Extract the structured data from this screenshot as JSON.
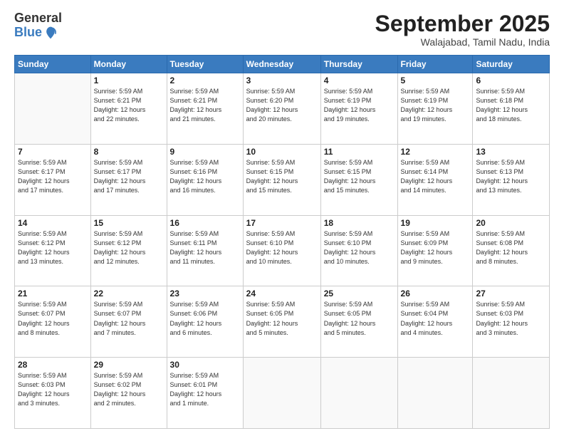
{
  "logo": {
    "general": "General",
    "blue": "Blue"
  },
  "title": "September 2025",
  "location": "Walajabad, Tamil Nadu, India",
  "days_header": [
    "Sunday",
    "Monday",
    "Tuesday",
    "Wednesday",
    "Thursday",
    "Friday",
    "Saturday"
  ],
  "weeks": [
    [
      {
        "num": "",
        "info": ""
      },
      {
        "num": "1",
        "info": "Sunrise: 5:59 AM\nSunset: 6:21 PM\nDaylight: 12 hours\nand 22 minutes."
      },
      {
        "num": "2",
        "info": "Sunrise: 5:59 AM\nSunset: 6:21 PM\nDaylight: 12 hours\nand 21 minutes."
      },
      {
        "num": "3",
        "info": "Sunrise: 5:59 AM\nSunset: 6:20 PM\nDaylight: 12 hours\nand 20 minutes."
      },
      {
        "num": "4",
        "info": "Sunrise: 5:59 AM\nSunset: 6:19 PM\nDaylight: 12 hours\nand 19 minutes."
      },
      {
        "num": "5",
        "info": "Sunrise: 5:59 AM\nSunset: 6:19 PM\nDaylight: 12 hours\nand 19 minutes."
      },
      {
        "num": "6",
        "info": "Sunrise: 5:59 AM\nSunset: 6:18 PM\nDaylight: 12 hours\nand 18 minutes."
      }
    ],
    [
      {
        "num": "7",
        "info": "Sunrise: 5:59 AM\nSunset: 6:17 PM\nDaylight: 12 hours\nand 17 minutes."
      },
      {
        "num": "8",
        "info": "Sunrise: 5:59 AM\nSunset: 6:17 PM\nDaylight: 12 hours\nand 17 minutes."
      },
      {
        "num": "9",
        "info": "Sunrise: 5:59 AM\nSunset: 6:16 PM\nDaylight: 12 hours\nand 16 minutes."
      },
      {
        "num": "10",
        "info": "Sunrise: 5:59 AM\nSunset: 6:15 PM\nDaylight: 12 hours\nand 15 minutes."
      },
      {
        "num": "11",
        "info": "Sunrise: 5:59 AM\nSunset: 6:15 PM\nDaylight: 12 hours\nand 15 minutes."
      },
      {
        "num": "12",
        "info": "Sunrise: 5:59 AM\nSunset: 6:14 PM\nDaylight: 12 hours\nand 14 minutes."
      },
      {
        "num": "13",
        "info": "Sunrise: 5:59 AM\nSunset: 6:13 PM\nDaylight: 12 hours\nand 13 minutes."
      }
    ],
    [
      {
        "num": "14",
        "info": "Sunrise: 5:59 AM\nSunset: 6:12 PM\nDaylight: 12 hours\nand 13 minutes."
      },
      {
        "num": "15",
        "info": "Sunrise: 5:59 AM\nSunset: 6:12 PM\nDaylight: 12 hours\nand 12 minutes."
      },
      {
        "num": "16",
        "info": "Sunrise: 5:59 AM\nSunset: 6:11 PM\nDaylight: 12 hours\nand 11 minutes."
      },
      {
        "num": "17",
        "info": "Sunrise: 5:59 AM\nSunset: 6:10 PM\nDaylight: 12 hours\nand 10 minutes."
      },
      {
        "num": "18",
        "info": "Sunrise: 5:59 AM\nSunset: 6:10 PM\nDaylight: 12 hours\nand 10 minutes."
      },
      {
        "num": "19",
        "info": "Sunrise: 5:59 AM\nSunset: 6:09 PM\nDaylight: 12 hours\nand 9 minutes."
      },
      {
        "num": "20",
        "info": "Sunrise: 5:59 AM\nSunset: 6:08 PM\nDaylight: 12 hours\nand 8 minutes."
      }
    ],
    [
      {
        "num": "21",
        "info": "Sunrise: 5:59 AM\nSunset: 6:07 PM\nDaylight: 12 hours\nand 8 minutes."
      },
      {
        "num": "22",
        "info": "Sunrise: 5:59 AM\nSunset: 6:07 PM\nDaylight: 12 hours\nand 7 minutes."
      },
      {
        "num": "23",
        "info": "Sunrise: 5:59 AM\nSunset: 6:06 PM\nDaylight: 12 hours\nand 6 minutes."
      },
      {
        "num": "24",
        "info": "Sunrise: 5:59 AM\nSunset: 6:05 PM\nDaylight: 12 hours\nand 5 minutes."
      },
      {
        "num": "25",
        "info": "Sunrise: 5:59 AM\nSunset: 6:05 PM\nDaylight: 12 hours\nand 5 minutes."
      },
      {
        "num": "26",
        "info": "Sunrise: 5:59 AM\nSunset: 6:04 PM\nDaylight: 12 hours\nand 4 minutes."
      },
      {
        "num": "27",
        "info": "Sunrise: 5:59 AM\nSunset: 6:03 PM\nDaylight: 12 hours\nand 3 minutes."
      }
    ],
    [
      {
        "num": "28",
        "info": "Sunrise: 5:59 AM\nSunset: 6:03 PM\nDaylight: 12 hours\nand 3 minutes."
      },
      {
        "num": "29",
        "info": "Sunrise: 5:59 AM\nSunset: 6:02 PM\nDaylight: 12 hours\nand 2 minutes."
      },
      {
        "num": "30",
        "info": "Sunrise: 5:59 AM\nSunset: 6:01 PM\nDaylight: 12 hours\nand 1 minute."
      },
      {
        "num": "",
        "info": ""
      },
      {
        "num": "",
        "info": ""
      },
      {
        "num": "",
        "info": ""
      },
      {
        "num": "",
        "info": ""
      }
    ]
  ]
}
